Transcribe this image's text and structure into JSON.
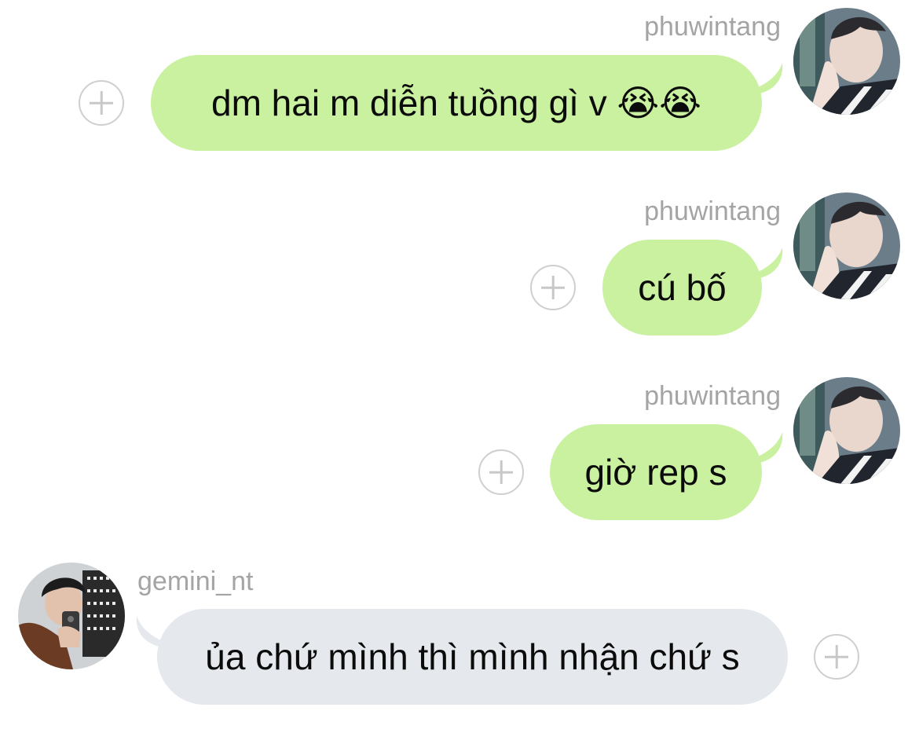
{
  "messages": [
    {
      "sender": "phuwintang",
      "direction": "outgoing",
      "text": "dm hai m diễn tuồng gì v 😭😭"
    },
    {
      "sender": "phuwintang",
      "direction": "outgoing",
      "text": "cú bố"
    },
    {
      "sender": "phuwintang",
      "direction": "outgoing",
      "text": "giờ rep s"
    },
    {
      "sender": "gemini_nt",
      "direction": "incoming",
      "text": "ủa chứ mình thì mình nhận chứ s"
    }
  ],
  "colors": {
    "outgoing_bubble": "#c9f19f",
    "incoming_bubble": "#e5e8ec",
    "sender_name": "#a4a4a4"
  },
  "icons": {
    "add_reaction": "plus-circle-icon"
  }
}
